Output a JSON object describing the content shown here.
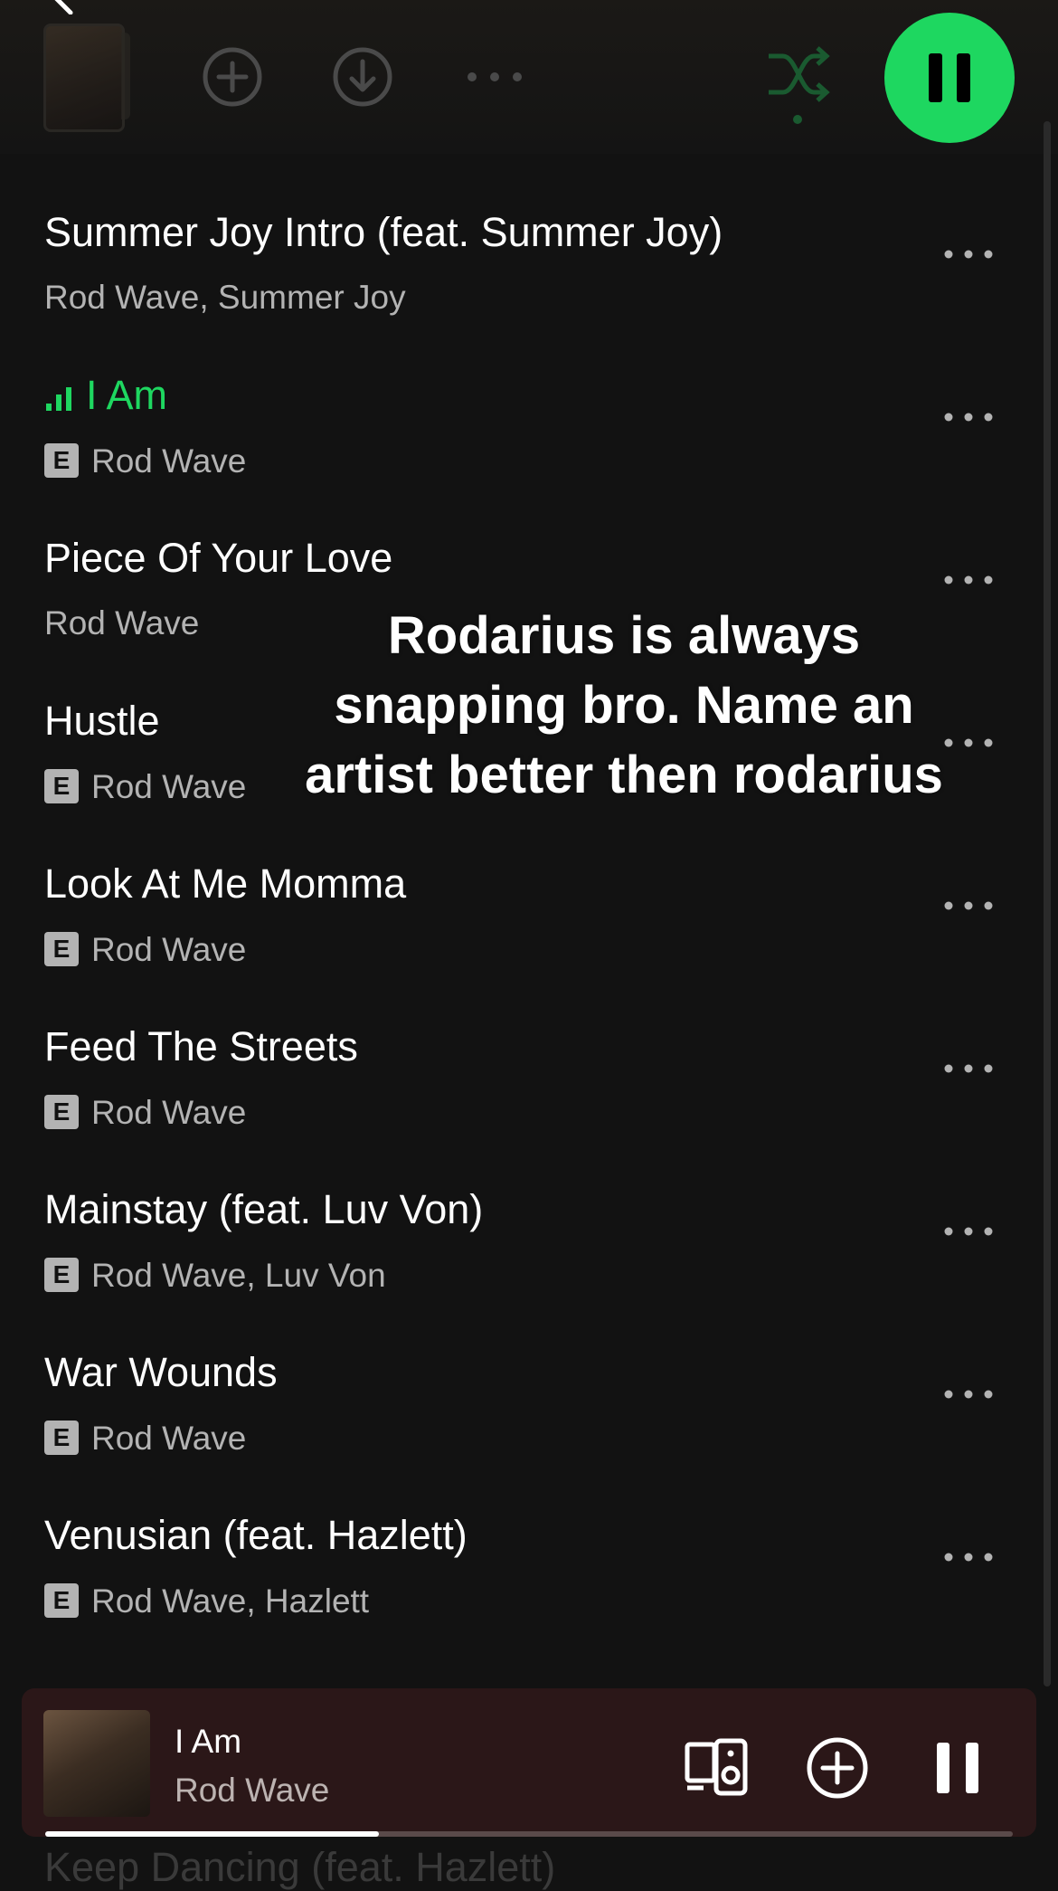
{
  "header": {
    "icons": [
      "back-icon",
      "album-thumb",
      "add-icon",
      "download-icon",
      "more-icon",
      "shuffle-icon",
      "pause-icon"
    ]
  },
  "colors": {
    "accent": "#1ed760",
    "background": "#121212",
    "subtext": "#b3b3b3",
    "mini_player_bg": "#2b1718"
  },
  "tracks": [
    {
      "title": "Summer Joy Intro (feat. Summer Joy)",
      "artist": "Rod Wave, Summer Joy",
      "explicit": false,
      "playing": false
    },
    {
      "title": "I Am",
      "artist": "Rod Wave",
      "explicit": true,
      "playing": true
    },
    {
      "title": "Piece Of Your Love",
      "artist": "Rod Wave",
      "explicit": false,
      "playing": false
    },
    {
      "title": "Hustle",
      "artist": "Rod Wave",
      "explicit": true,
      "playing": false
    },
    {
      "title": "Look At Me Momma",
      "artist": "Rod Wave",
      "explicit": true,
      "playing": false
    },
    {
      "title": "Feed The Streets",
      "artist": "Rod Wave",
      "explicit": true,
      "playing": false
    },
    {
      "title": "Mainstay (feat. Luv Von)",
      "artist": "Rod Wave, Luv Von",
      "explicit": true,
      "playing": false
    },
    {
      "title": "War Wounds",
      "artist": "Rod Wave",
      "explicit": true,
      "playing": false
    },
    {
      "title": "Venusian (feat. Hazlett)",
      "artist": "Rod Wave, Hazlett",
      "explicit": true,
      "playing": false
    }
  ],
  "explicit_label": "E",
  "peek_track": "Keep Dancing (feat. Hazlett)",
  "overlay": {
    "lines": [
      "Rodarius is always",
      "snapping bro. Name an",
      "artist better then rodarius"
    ]
  },
  "mini_player": {
    "title": "I Am",
    "artist": "Rod Wave",
    "progress": 0.345,
    "icons": [
      "connect-device-icon",
      "add-icon",
      "pause-icon"
    ]
  }
}
